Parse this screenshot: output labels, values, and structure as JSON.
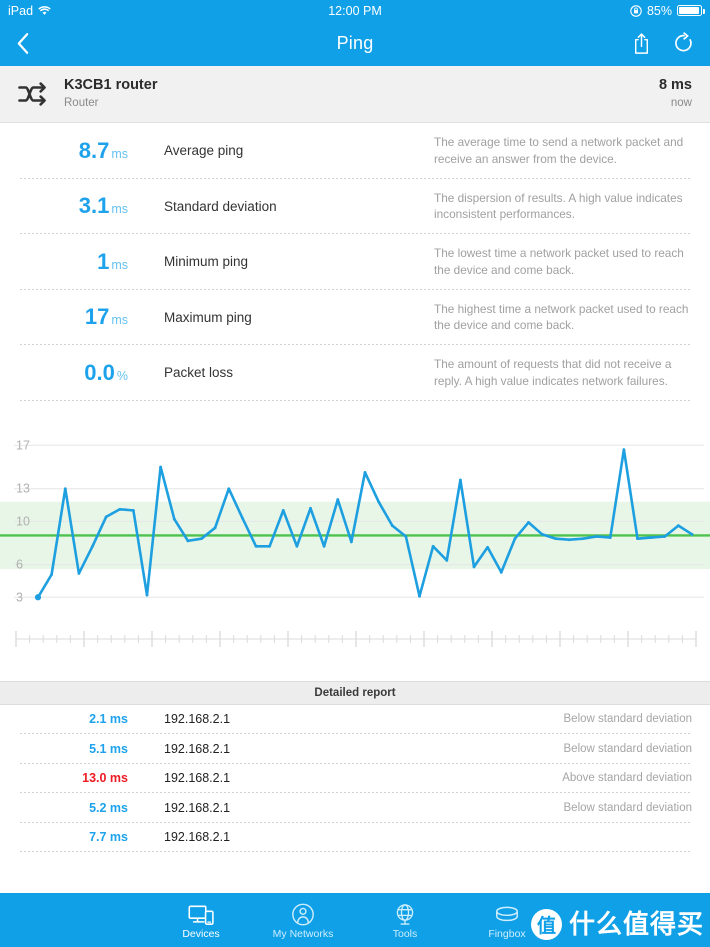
{
  "status_bar": {
    "device_label": "iPad",
    "wifi_icon": "wifi-icon",
    "time": "12:00 PM",
    "orientation_lock_icon": "rotation-lock-icon",
    "battery_percent": "85%",
    "battery_icon": "battery-icon"
  },
  "nav_bar": {
    "back_icon": "chevron-left-icon",
    "title": "Ping",
    "share_icon": "share-icon",
    "refresh_icon": "refresh-icon"
  },
  "device_header": {
    "icon": "shuffle-icon",
    "name": "K3CB1 router",
    "type": "Router",
    "latency": "8 ms",
    "timestamp": "now"
  },
  "stats": [
    {
      "value": "8.7",
      "unit": "ms",
      "label": "Average ping",
      "description": "The average time to send a network packet and receive an answer from the device."
    },
    {
      "value": "3.1",
      "unit": "ms",
      "label": "Standard deviation",
      "description": "The dispersion of results. A high value indicates inconsistent performances."
    },
    {
      "value": "1",
      "unit": "ms",
      "label": "Minimum ping",
      "description": "The lowest time a network packet used to reach the device and come back."
    },
    {
      "value": "17",
      "unit": "ms",
      "label": "Maximum ping",
      "description": "The highest time a network packet used to reach the device and come back."
    },
    {
      "value": "0.0",
      "unit": "%",
      "label": "Packet loss",
      "description": "The amount of requests that did not receive a reply. A high value indicates network failures."
    }
  ],
  "chart_data": {
    "type": "line",
    "title": "",
    "xlabel": "",
    "ylabel": "",
    "ytick_labels": [
      "17",
      "13",
      "10",
      "6",
      "3"
    ],
    "yticks": [
      17,
      13,
      10,
      6,
      3
    ],
    "ylim": [
      1,
      18.5
    ],
    "grid": true,
    "legend": null,
    "line_color": "#1d9fe0",
    "mean_line_color": "#4dc24d",
    "band_color": "#e8f6e8",
    "mean_value": 8.7,
    "band_upper": 11.8,
    "band_lower": 5.6,
    "series": [
      {
        "name": "Ping (ms)",
        "values": [
          3.0,
          5.1,
          13.0,
          5.2,
          7.7,
          10.4,
          11.1,
          11.0,
          3.2,
          15.0,
          10.2,
          8.2,
          8.4,
          9.4,
          13.0,
          10.3,
          7.7,
          7.7,
          11.0,
          7.7,
          11.2,
          7.7,
          12.0,
          8.1,
          14.5,
          11.8,
          9.6,
          8.6,
          3.1,
          7.7,
          6.4,
          13.8,
          5.8,
          7.6,
          5.3,
          8.4,
          9.9,
          8.8,
          8.4,
          8.3,
          8.4,
          8.6,
          8.5,
          16.6,
          8.4,
          8.5,
          8.6,
          9.6,
          8.8
        ]
      }
    ]
  },
  "detailed_report": {
    "header": "Detailed report",
    "rows": [
      {
        "ms": "2.1 ms",
        "ip": "192.168.2.1",
        "status": "Below standard deviation",
        "level": "below"
      },
      {
        "ms": "5.1 ms",
        "ip": "192.168.2.1",
        "status": "Below standard deviation",
        "level": "below"
      },
      {
        "ms": "13.0 ms",
        "ip": "192.168.2.1",
        "status": "Above standard deviation",
        "level": "above"
      },
      {
        "ms": "5.2 ms",
        "ip": "192.168.2.1",
        "status": "Below standard deviation",
        "level": "below"
      },
      {
        "ms": "7.7 ms",
        "ip": "192.168.2.1",
        "status": "",
        "level": "below"
      }
    ]
  },
  "tab_bar": {
    "tabs": [
      {
        "label": "Devices",
        "icon": "devices-icon",
        "active": true
      },
      {
        "label": "My Networks",
        "icon": "person-icon",
        "active": false
      },
      {
        "label": "Tools",
        "icon": "globe-icon",
        "active": false
      },
      {
        "label": "Fingbox",
        "icon": "fingbox-icon",
        "active": false
      }
    ]
  },
  "watermark": {
    "badge": "值",
    "text": "什么值得买"
  },
  "colors": {
    "brand_blue": "#0fa0e8",
    "value_blue": "#1ea2ec",
    "alert_red": "#ee1c25",
    "mean_green": "#4dc24d"
  }
}
